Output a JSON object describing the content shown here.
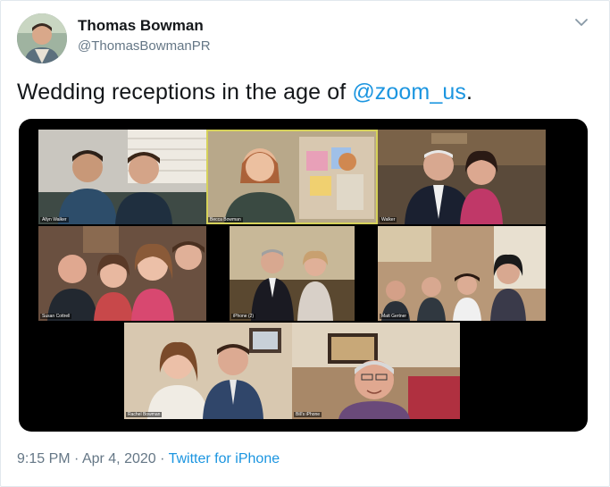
{
  "tweet": {
    "author_name": "Thomas Bowman",
    "author_handle": "@ThomasBowmanPR",
    "text_prefix": "Wedding receptions in the age of ",
    "mention": "@zoom_us",
    "text_suffix": ".",
    "time": "9:15 PM",
    "separator": " · ",
    "date": "Apr 4, 2020",
    "source": "Twitter for iPhone"
  },
  "zoom_tiles": [
    {
      "label": "Allyn Walker"
    },
    {
      "label": "Becca Bowman"
    },
    {
      "label": "Walker"
    },
    {
      "label": "Susan Cottrell"
    },
    {
      "label": "iPhone (2)"
    },
    {
      "label": "Matt Gertner"
    },
    {
      "label": "Rachel Bowman"
    },
    {
      "label": "Bill's iPhone"
    }
  ],
  "colors": {
    "link": "#1b95e0",
    "meta": "#657786",
    "text": "#14171a",
    "active_speaker": "#d6d25a"
  },
  "icons": {
    "caret": "chevron-down-icon"
  }
}
